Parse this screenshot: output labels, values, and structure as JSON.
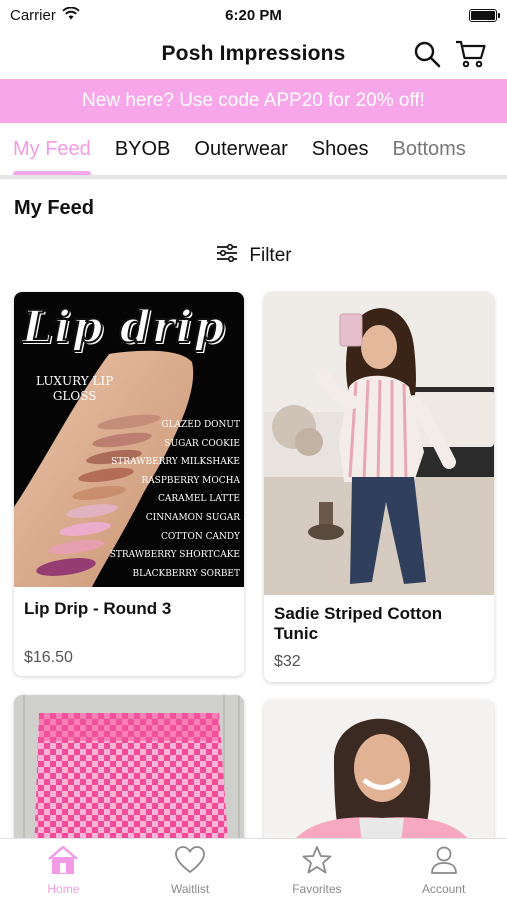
{
  "status": {
    "carrier": "Carrier",
    "time": "6:20 PM"
  },
  "header": {
    "title": "Posh Impressions"
  },
  "promo": {
    "text": "New here? Use code APP20 for 20% off!"
  },
  "tabs": [
    {
      "label": "My Feed"
    },
    {
      "label": "BYOB"
    },
    {
      "label": "Outerwear"
    },
    {
      "label": "Shoes"
    },
    {
      "label": "Bottoms"
    }
  ],
  "section": {
    "title": "My Feed"
  },
  "filter": {
    "label": "Filter"
  },
  "products": [
    {
      "name": "Lip Drip - Round 3",
      "price": "$16.50"
    },
    {
      "name": "Sadie Striped Cotton Tunic",
      "price": "$32"
    },
    {
      "name": "",
      "price": ""
    },
    {
      "name": "",
      "price": ""
    }
  ],
  "lipdrip": {
    "title": "Lip drip",
    "subtitle1": "LUXURY LIP",
    "subtitle2": "GLOSS",
    "shades": [
      "GLAZED DONUT",
      "SUGAR COOKIE",
      "STRAWBERRY MILKSHAKE",
      "RASPBERRY MOCHA",
      "CARAMEL LATTE",
      "CINNAMON SUGAR",
      "COTTON CANDY",
      "STRAWBERRY SHORTCAKE",
      "BLACKBERRY SORBET"
    ]
  },
  "bottom_nav": [
    {
      "label": "Home",
      "icon": "home-icon"
    },
    {
      "label": "Waitlist",
      "icon": "heart-icon"
    },
    {
      "label": "Favorites",
      "icon": "star-icon"
    },
    {
      "label": "Account",
      "icon": "account-icon"
    }
  ],
  "colors": {
    "accent": "#f7a6ea",
    "accent_text": "#f29be4"
  }
}
